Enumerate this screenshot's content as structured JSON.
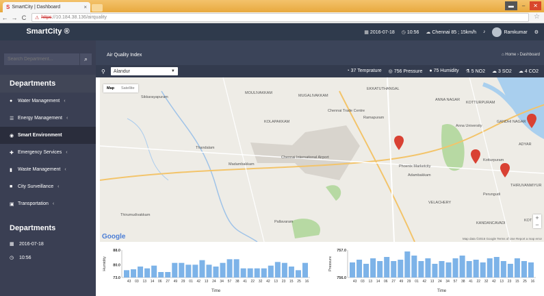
{
  "browser": {
    "tab_title": "SmartCity | Dashboard",
    "tab_close": "×",
    "url_protocol": "https",
    "url_rest": "://10.184.38.136/airquality",
    "window_buttons": [
      "▬",
      "–",
      "✕"
    ]
  },
  "header": {
    "brand": "SmartCity ®",
    "date": "2016-07-18",
    "time": "10:56",
    "weather": "Chennai 85 ; 15km/h",
    "user": "Ramkumar"
  },
  "sidebar": {
    "search_placeholder": "Search Department...",
    "heading": "Departments",
    "items": [
      {
        "label": "Water Management",
        "icon": "tint-icon"
      },
      {
        "label": "Energy Management",
        "icon": "sliders-icon"
      },
      {
        "label": "Smart Environment",
        "icon": "globe-icon"
      },
      {
        "label": "Emergency Services",
        "icon": "lifebuoy-icon"
      },
      {
        "label": "Waste Management",
        "icon": "trash-icon"
      },
      {
        "label": "City Surveillance",
        "icon": "camera-icon"
      },
      {
        "label": "Transportation",
        "icon": "bus-icon"
      }
    ],
    "heading2": "Departments",
    "info_date": "2016-07-18",
    "info_time": "10:56"
  },
  "content": {
    "title": "Air Quality Index",
    "breadcrumb_home": "Home",
    "breadcrumb_current": "Dashboard",
    "location": "Alandur",
    "metrics": {
      "temperature": "37 Temprature",
      "pressure": "756 Pressure",
      "humidity": "75 Humidity",
      "no2": "5 NO2",
      "so2": "3 SO2",
      "co2": "4 CO2"
    }
  },
  "map": {
    "toggle_map": "Map",
    "toggle_satellite": "Satellite",
    "labels": [
      "MOULIVAKKAM",
      "MUGALIVAKKAM",
      "EKKATUTHANGAL",
      "ANNA NAGAR",
      "KOTTURPURAM",
      "Sikkarayapuram",
      "KOLAPAKKAM",
      "Ramapuram",
      "Chennai Trade Centre",
      "GANDHI NAGAR",
      "ADYAR",
      "Thandalam",
      "Madambakkam",
      "Chennai International Airport",
      "Phoenix Marketcity",
      "Kotturpuram",
      "THIRUVANMIYUR",
      "VELACHERY",
      "KANDANCAVADI",
      "Thirumudivakkam",
      "Pallavaram",
      "KOT",
      "Anna University",
      "Perungudi",
      "Adambakkam"
    ],
    "logo": "Google",
    "footer": "Map data ©2016 Google  Terms of Use  Report a map error",
    "zoom_in": "+",
    "zoom_out": "−"
  },
  "chart_data": [
    {
      "type": "bar",
      "title": "",
      "xlabel": "Time",
      "ylabel": "Humidity",
      "ylim": [
        73.0,
        88.0
      ],
      "yticks": [
        "88.0",
        "80.0",
        "73.0"
      ],
      "categories": [
        "43",
        "03",
        "13",
        "14",
        "06",
        "27",
        "49",
        "29",
        "01",
        "42",
        "13",
        "24",
        "34",
        "57",
        "38",
        "41",
        "22",
        "32",
        "42",
        "13",
        "23",
        "15",
        "25",
        "16"
      ],
      "values": [
        77,
        77.5,
        79,
        78,
        79.5,
        76,
        76,
        81,
        81,
        80,
        80,
        82.5,
        80,
        79,
        81,
        83,
        83,
        78,
        78,
        78,
        78,
        79.5,
        81.5,
        81,
        79,
        77,
        81
      ]
    },
    {
      "type": "bar",
      "title": "",
      "xlabel": "Time",
      "ylabel": "Pressure",
      "ylim": [
        756.0,
        757.0
      ],
      "yticks": [
        "757.0",
        "756.0"
      ],
      "categories": [
        "43",
        "03",
        "13",
        "14",
        "06",
        "27",
        "49",
        "29",
        "01",
        "42",
        "13",
        "24",
        "34",
        "57",
        "38",
        "41",
        "22",
        "32",
        "42",
        "13",
        "23",
        "15",
        "25",
        "16"
      ],
      "values": [
        756.55,
        756.65,
        756.5,
        756.7,
        756.6,
        756.75,
        756.6,
        756.65,
        756.95,
        756.8,
        756.6,
        756.7,
        756.5,
        756.6,
        756.55,
        756.7,
        756.8,
        756.6,
        756.65,
        756.55,
        756.7,
        756.75,
        756.6,
        756.5,
        756.7,
        756.6,
        756.55
      ]
    }
  ]
}
